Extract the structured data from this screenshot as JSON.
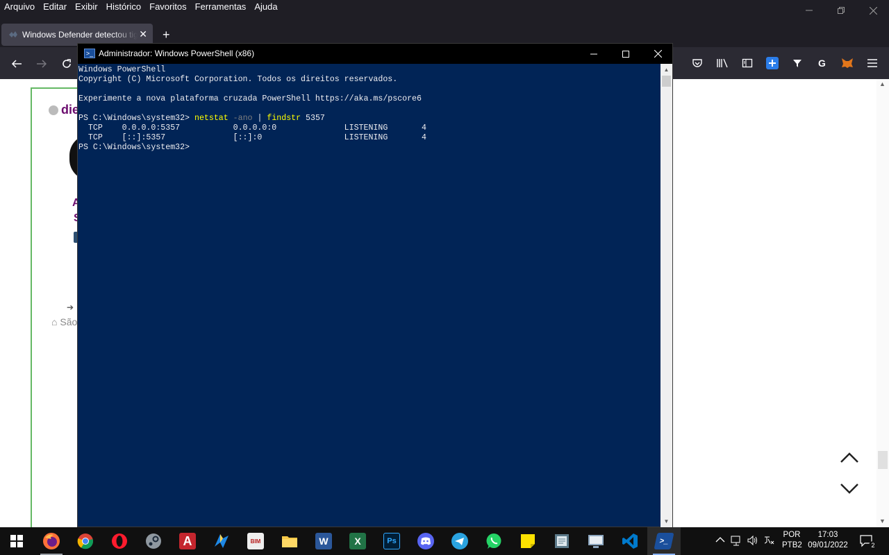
{
  "firefox": {
    "menu": [
      "Arquivo",
      "Editar",
      "Exibir",
      "Histórico",
      "Favoritos",
      "Ferramentas",
      "Ajuda"
    ],
    "tab_title": "Windows Defender detectou tig",
    "new_tab": "+",
    "page": {
      "name_fragment": "die",
      "heading_a": "A",
      "heading_s": "S",
      "city_fragment": "São"
    }
  },
  "powershell": {
    "title": "Administrador: Windows PowerShell (x86)",
    "lines": {
      "l1": "Windows PowerShell",
      "l2": "Copyright (C) Microsoft Corporation. Todos os direitos reservados.",
      "l3": "Experimente a nova plataforma cruzada PowerShell https://aka.ms/pscore6",
      "prompt": "PS C:\\Windows\\system32> ",
      "cmd_netstat": "netstat",
      "arg_ano": "-ano",
      "pipe": " | ",
      "cmd_findstr": "findstr",
      "arg_port": " 5357",
      "r1": "  TCP    0.0.0.0:5357           0.0.0.0:0              LISTENING       4",
      "r2": "  TCP    [::]:5357              [::]:0                 LISTENING       4",
      "prompt2": "PS C:\\Windows\\system32>"
    }
  },
  "taskbar": {
    "apps": [
      {
        "name": "firefox",
        "color": "#ff7139"
      },
      {
        "name": "chrome",
        "color": "#4285f4"
      },
      {
        "name": "opera",
        "color": "#ff1b2d"
      },
      {
        "name": "steam",
        "color": "#8f98a0"
      },
      {
        "name": "autocad",
        "color": "#c4262e"
      },
      {
        "name": "maps",
        "color": "#1e88e5"
      },
      {
        "name": "bim-sight",
        "color": "#b71c1c"
      },
      {
        "name": "file-explorer",
        "color": "#f7c948"
      },
      {
        "name": "word",
        "color": "#2b579a"
      },
      {
        "name": "excel",
        "color": "#217346"
      },
      {
        "name": "photoshop",
        "color": "#001e36"
      },
      {
        "name": "discord",
        "color": "#5865f2"
      },
      {
        "name": "telegram",
        "color": "#2aa3e0"
      },
      {
        "name": "whatsapp",
        "color": "#25d366"
      },
      {
        "name": "sticky-notes",
        "color": "#fce100"
      },
      {
        "name": "notepad",
        "color": "#5c7a8a"
      },
      {
        "name": "control-panel",
        "color": "#8da7c0"
      },
      {
        "name": "vscode",
        "color": "#007acc"
      },
      {
        "name": "powershell",
        "color": "#1a4f9c"
      }
    ],
    "app_labels": {
      "word": "W",
      "excel": "X",
      "photoshop": "Ps",
      "autocad": "A",
      "bim": "BIM"
    },
    "lang_top": "POR",
    "lang_bottom": "PTB2",
    "time": "17:03",
    "date": "09/01/2022",
    "notifications": "2"
  }
}
